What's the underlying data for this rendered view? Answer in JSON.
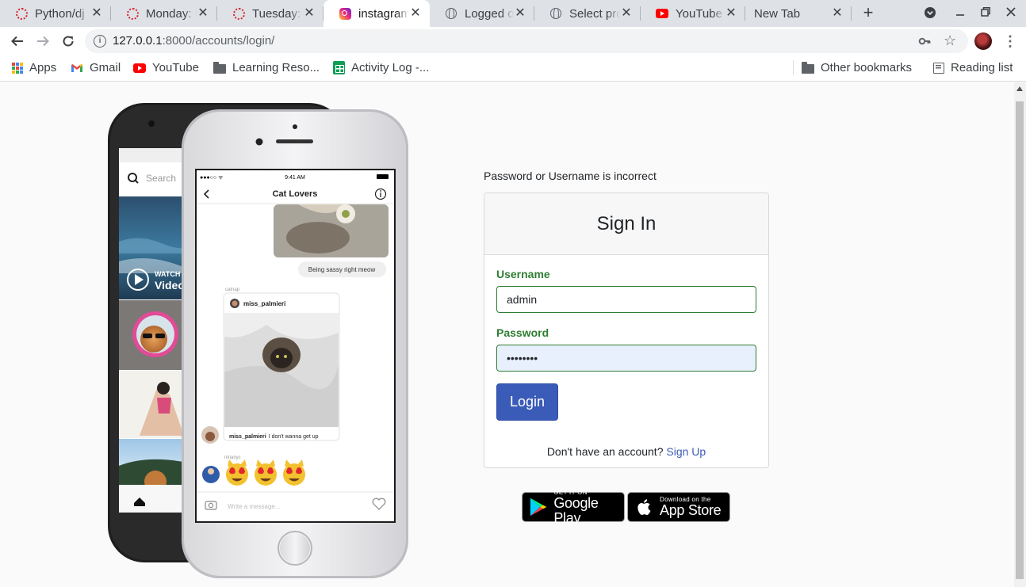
{
  "browser": {
    "tabs": [
      {
        "title": "Python/dj",
        "icon": "red-ring-icon",
        "active": false
      },
      {
        "title": "Monday: U",
        "icon": "red-ring-icon",
        "active": false
      },
      {
        "title": "Tuesday: h",
        "icon": "red-ring-icon",
        "active": false
      },
      {
        "title": "instagram",
        "icon": "instagram-icon",
        "active": true
      },
      {
        "title": "Logged ou",
        "icon": "globe-icon",
        "active": false
      },
      {
        "title": "Select pro",
        "icon": "globe-icon",
        "active": false
      },
      {
        "title": "YouTube",
        "icon": "youtube-icon",
        "active": false
      },
      {
        "title": "New Tab",
        "icon": "",
        "active": false
      }
    ],
    "url": {
      "host": "127.0.0.1",
      "path": ":8000/accounts/login/"
    },
    "bookmarks": [
      {
        "label": "Apps",
        "icon": "apps-grid-icon"
      },
      {
        "label": "Gmail",
        "icon": "gmail-icon"
      },
      {
        "label": "YouTube",
        "icon": "youtube-icon"
      },
      {
        "label": "Learning Reso...",
        "icon": "folder-icon"
      },
      {
        "label": "Activity Log -...",
        "icon": "sheets-icon"
      }
    ],
    "other_bookmarks": "Other bookmarks",
    "reading_list": "Reading list"
  },
  "phone": {
    "search_placeholder": "Search",
    "watch_label": "WATCH",
    "video_label": "Video",
    "status_time": "9:41 AM",
    "chat_title": "Cat Lovers",
    "sassy_message": "Being sassy right meow",
    "sender_small": "catnap",
    "post_user": "miss_palmieri",
    "caption_user": "miss_palmieri",
    "caption_text": "I don't wanna get up",
    "emoji_sender": "ninanyc",
    "message_placeholder": "Write a message..."
  },
  "login": {
    "error": "Password or Username is incorrect",
    "title": "Sign In",
    "username_label": "Username",
    "username_value": "admin",
    "password_label": "Password",
    "password_value": "••••••••",
    "login_button": "Login",
    "no_account": "Don't have an account?",
    "signup_link": "Sign Up"
  },
  "stores": {
    "google_small": "GET IT ON",
    "google_big": "Google Play",
    "apple_small": "Download on the",
    "apple_big": "App Store"
  },
  "colors": {
    "accent": "#3b5bb8",
    "label_green": "#2e7d32",
    "autofill": "#e8f0fe",
    "page_bg": "#fafafa"
  }
}
